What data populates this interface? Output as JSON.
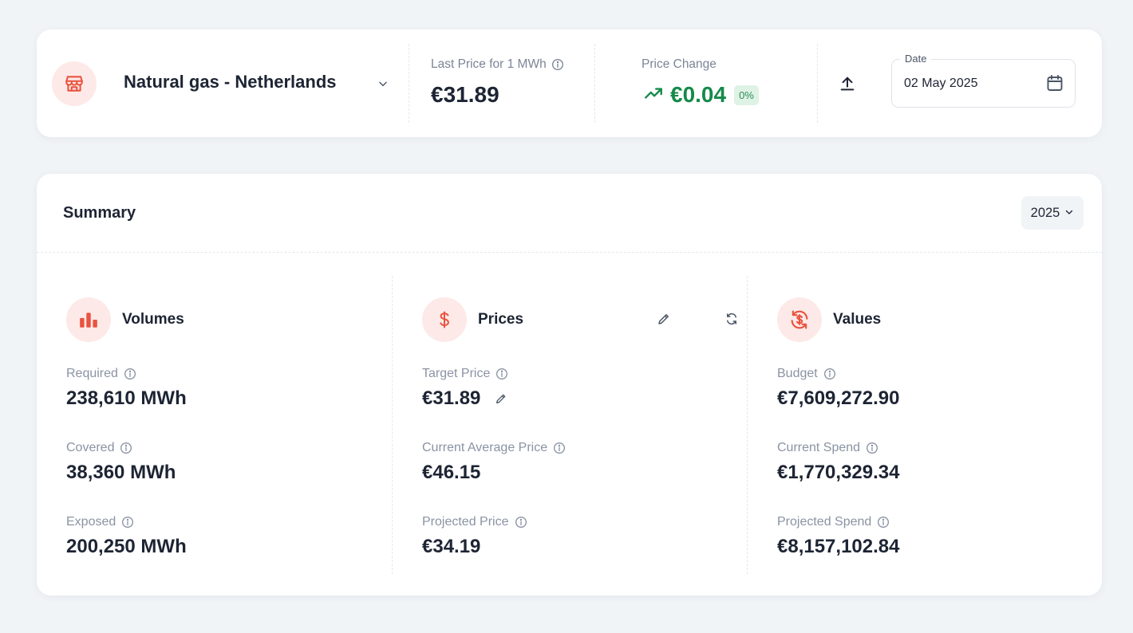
{
  "colors": {
    "accent": "#e9533f",
    "accent_bg": "#fde9e7",
    "positive": "#158a4a",
    "positive_bg": "#dff2e6",
    "muted_text": "#8a93a3",
    "page_bg": "#f1f4f7"
  },
  "header": {
    "market_icon": "store-icon",
    "market_name": "Natural gas - Netherlands",
    "last_price_label": "Last Price for 1 MWh",
    "last_price_value": "€31.89",
    "price_change_label": "Price Change",
    "price_change_icon": "trending-up-icon",
    "price_change_value": "€0.04",
    "price_change_percent": "0%",
    "upload_icon": "upload-icon",
    "date_label": "Date",
    "date_value": "02 May 2025",
    "date_icon": "calendar-icon"
  },
  "summary": {
    "title": "Summary",
    "year": "2025",
    "columns": [
      {
        "title": "Volumes",
        "icon": "bar-chart-icon",
        "metrics": [
          {
            "label": "Required",
            "value": "238,610 MWh"
          },
          {
            "label": "Covered",
            "value": "38,360 MWh"
          },
          {
            "label": "Exposed",
            "value": "200,250 MWh"
          }
        ]
      },
      {
        "title": "Prices",
        "icon": "dollar-icon",
        "actions": [
          "edit-icon",
          "refresh-icon"
        ],
        "metrics": [
          {
            "label": "Target Price",
            "value": "€31.89"
          },
          {
            "label": "Current Average Price",
            "value": "€46.15"
          },
          {
            "label": "Projected Price",
            "value": "€34.19"
          }
        ]
      },
      {
        "title": "Values",
        "icon": "currency-exchange-icon",
        "metrics": [
          {
            "label": "Budget",
            "value": "€7,609,272.90"
          },
          {
            "label": "Current Spend",
            "value": "€1,770,329.34"
          },
          {
            "label": "Projected Spend",
            "value": "€8,157,102.84"
          }
        ]
      }
    ]
  }
}
